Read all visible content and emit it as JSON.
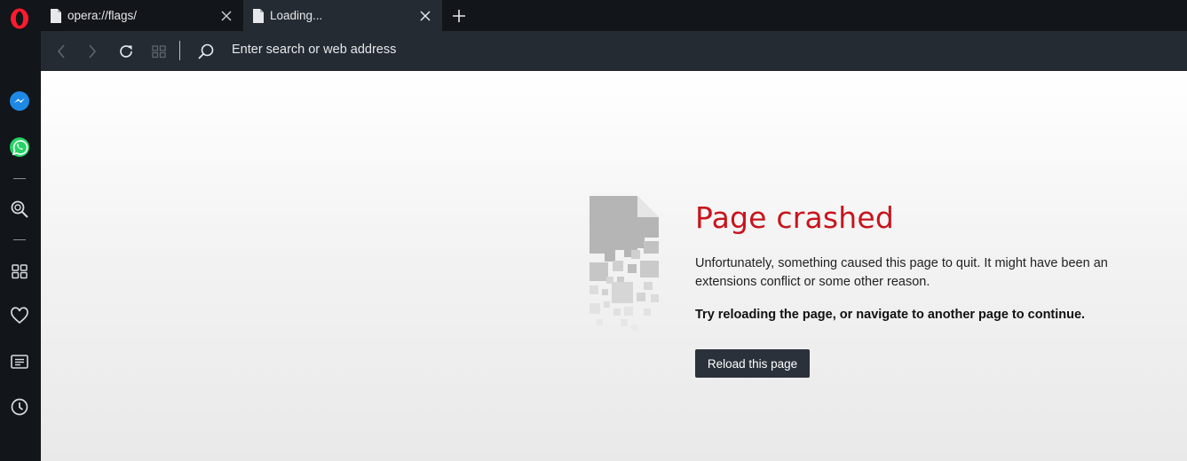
{
  "tabs": [
    {
      "title": "opera://flags/",
      "active": false
    },
    {
      "title": "Loading...",
      "active": true
    }
  ],
  "toolbar": {
    "address_placeholder": "Enter search or web address"
  },
  "sidebar": {
    "items": [
      "opera-logo-icon",
      "messenger-icon",
      "whatsapp-icon",
      "search-icon",
      "speed-dial-icon",
      "heart-icon",
      "news-icon",
      "history-icon"
    ]
  },
  "crash": {
    "title": "Page crashed",
    "description": "Unfortunately, something caused this page to quit. It might have been an extensions conflict or some other reason.",
    "hint": "Try reloading the page, or navigate to another page to continue.",
    "reload_label": "Reload this page"
  },
  "colors": {
    "title_red": "#c8141c",
    "opera_red": "#ff1b2d",
    "toolbar": "#252b33",
    "frame": "#121519"
  }
}
